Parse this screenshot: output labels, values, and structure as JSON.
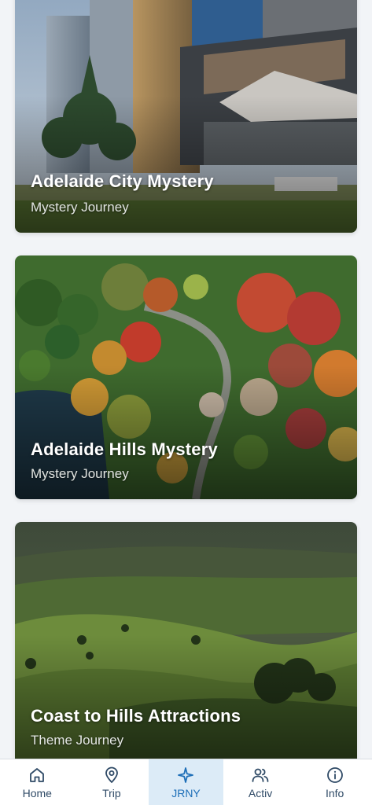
{
  "journeys": [
    {
      "title": "Adelaide City Mystery",
      "subtitle": "Mystery Journey"
    },
    {
      "title": "Adelaide Hills Mystery",
      "subtitle": "Mystery Journey"
    },
    {
      "title": "Coast to Hills Attractions",
      "subtitle": "Theme Journey"
    }
  ],
  "tabs": [
    {
      "label": "Home",
      "icon": "home-icon"
    },
    {
      "label": "Trip",
      "icon": "map-pin-icon"
    },
    {
      "label": "JRNY",
      "icon": "sparkle-icon",
      "active": true
    },
    {
      "label": "Activ",
      "icon": "users-icon"
    },
    {
      "label": "Info",
      "icon": "info-icon"
    }
  ],
  "colors": {
    "background": "#f2f4f7",
    "tab_active_bg": "#dcebf7",
    "tab_active_text": "#1e6fb8",
    "tab_text": "#2f4a66"
  }
}
